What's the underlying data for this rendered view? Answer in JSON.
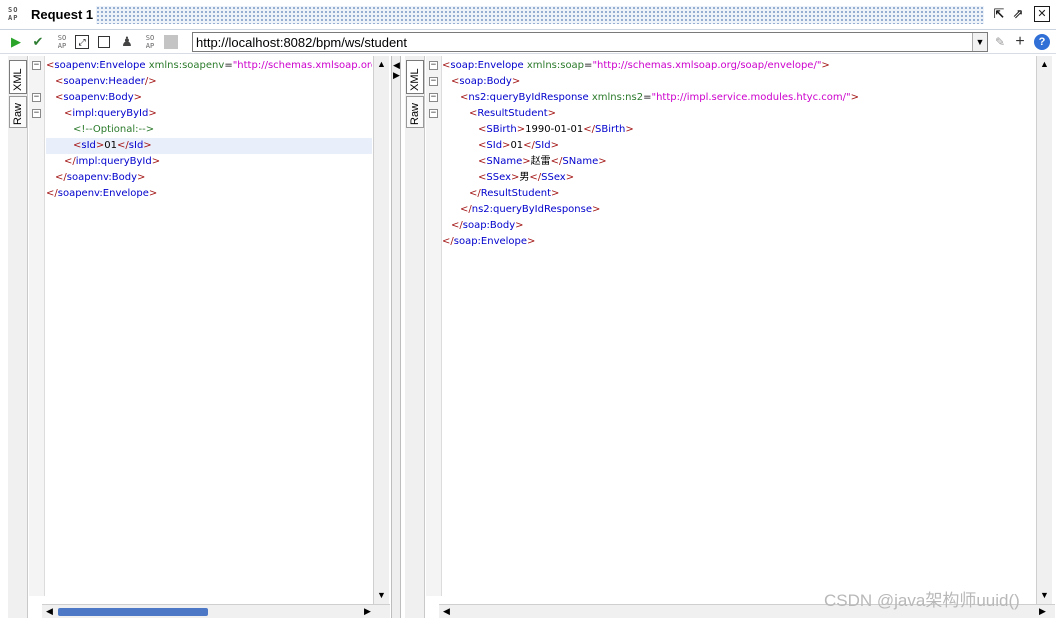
{
  "titlebar": {
    "logo": "SO\nAP",
    "title": "Request 1"
  },
  "toolbar": {
    "url": "http://localhost:8082/bpm/ws/student"
  },
  "request_panel": {
    "tabs": [
      "XML",
      "Raw"
    ],
    "lines": [
      {
        "fold": "−",
        "indent": 0,
        "parts": [
          [
            "t",
            "<"
          ],
          [
            "n",
            "soapenv:Envelope "
          ],
          [
            "a",
            "xmlns:soapenv"
          ],
          [
            "x",
            "="
          ],
          [
            "v",
            "\"http://schemas.xmlsoap.org/so"
          ]
        ]
      },
      {
        "fold": "",
        "indent": 1,
        "parts": [
          [
            "t",
            "<"
          ],
          [
            "n",
            "soapenv:Header"
          ],
          [
            "t",
            "/>"
          ]
        ]
      },
      {
        "fold": "−",
        "indent": 1,
        "parts": [
          [
            "t",
            "<"
          ],
          [
            "n",
            "soapenv:Body"
          ],
          [
            "t",
            ">"
          ]
        ]
      },
      {
        "fold": "−",
        "indent": 2,
        "parts": [
          [
            "t",
            "<"
          ],
          [
            "n",
            "impl:queryById"
          ],
          [
            "t",
            ">"
          ]
        ]
      },
      {
        "fold": "",
        "indent": 3,
        "parts": [
          [
            "c",
            "<!--Optional:-->"
          ]
        ]
      },
      {
        "fold": "",
        "indent": 3,
        "hl": true,
        "parts": [
          [
            "t",
            "<"
          ],
          [
            "n",
            "sId"
          ],
          [
            "t",
            ">"
          ],
          [
            "x",
            "01"
          ],
          [
            "t",
            "</"
          ],
          [
            "n",
            "sId"
          ],
          [
            "t",
            ">"
          ]
        ]
      },
      {
        "fold": "",
        "indent": 2,
        "parts": [
          [
            "t",
            "</"
          ],
          [
            "n",
            "impl:queryById"
          ],
          [
            "t",
            ">"
          ]
        ]
      },
      {
        "fold": "",
        "indent": 1,
        "parts": [
          [
            "t",
            "</"
          ],
          [
            "n",
            "soapenv:Body"
          ],
          [
            "t",
            ">"
          ]
        ]
      },
      {
        "fold": "",
        "indent": 0,
        "parts": [
          [
            "t",
            "</"
          ],
          [
            "n",
            "soapenv:Envelope"
          ],
          [
            "t",
            ">"
          ]
        ]
      }
    ]
  },
  "response_panel": {
    "tabs": [
      "XML",
      "Raw"
    ],
    "lines": [
      {
        "fold": "−",
        "indent": 0,
        "parts": [
          [
            "t",
            "<"
          ],
          [
            "n",
            "soap:Envelope "
          ],
          [
            "a",
            "xmlns:soap"
          ],
          [
            "x",
            "="
          ],
          [
            "v",
            "\"http://schemas.xmlsoap.org/soap/envelope/\""
          ],
          [
            "t",
            ">"
          ]
        ]
      },
      {
        "fold": "−",
        "indent": 1,
        "parts": [
          [
            "t",
            "<"
          ],
          [
            "n",
            "soap:Body"
          ],
          [
            "t",
            ">"
          ]
        ]
      },
      {
        "fold": "−",
        "indent": 2,
        "parts": [
          [
            "t",
            "<"
          ],
          [
            "n",
            "ns2:queryByIdResponse "
          ],
          [
            "a",
            "xmlns:ns2"
          ],
          [
            "x",
            "="
          ],
          [
            "v",
            "\"http://impl.service.modules.htyc.com/\""
          ],
          [
            "t",
            ">"
          ]
        ]
      },
      {
        "fold": "−",
        "indent": 3,
        "parts": [
          [
            "t",
            "<"
          ],
          [
            "n",
            "ResultStudent"
          ],
          [
            "t",
            ">"
          ]
        ]
      },
      {
        "fold": "",
        "indent": 4,
        "parts": [
          [
            "t",
            "<"
          ],
          [
            "n",
            "SBirth"
          ],
          [
            "t",
            ">"
          ],
          [
            "x",
            "1990-01-01"
          ],
          [
            "t",
            "</"
          ],
          [
            "n",
            "SBirth"
          ],
          [
            "t",
            ">"
          ]
        ]
      },
      {
        "fold": "",
        "indent": 4,
        "parts": [
          [
            "t",
            "<"
          ],
          [
            "n",
            "SId"
          ],
          [
            "t",
            ">"
          ],
          [
            "x",
            "01"
          ],
          [
            "t",
            "</"
          ],
          [
            "n",
            "SId"
          ],
          [
            "t",
            ">"
          ]
        ]
      },
      {
        "fold": "",
        "indent": 4,
        "parts": [
          [
            "t",
            "<"
          ],
          [
            "n",
            "SName"
          ],
          [
            "t",
            ">"
          ],
          [
            "x",
            "赵雷"
          ],
          [
            "t",
            "</"
          ],
          [
            "n",
            "SName"
          ],
          [
            "t",
            ">"
          ]
        ]
      },
      {
        "fold": "",
        "indent": 4,
        "parts": [
          [
            "t",
            "<"
          ],
          [
            "n",
            "SSex"
          ],
          [
            "t",
            ">"
          ],
          [
            "x",
            "男"
          ],
          [
            "t",
            "</"
          ],
          [
            "n",
            "SSex"
          ],
          [
            "t",
            ">"
          ]
        ]
      },
      {
        "fold": "",
        "indent": 3,
        "parts": [
          [
            "t",
            "</"
          ],
          [
            "n",
            "ResultStudent"
          ],
          [
            "t",
            ">"
          ]
        ]
      },
      {
        "fold": "",
        "indent": 2,
        "parts": [
          [
            "t",
            "</"
          ],
          [
            "n",
            "ns2:queryByIdResponse"
          ],
          [
            "t",
            ">"
          ]
        ]
      },
      {
        "fold": "",
        "indent": 1,
        "parts": [
          [
            "t",
            "</"
          ],
          [
            "n",
            "soap:Body"
          ],
          [
            "t",
            ">"
          ]
        ]
      },
      {
        "fold": "",
        "indent": 0,
        "parts": [
          [
            "t",
            "</"
          ],
          [
            "n",
            "soap:Envelope"
          ],
          [
            "t",
            ">"
          ]
        ]
      }
    ]
  },
  "watermark": "CSDN @java架构师uuid()",
  "colors": {
    "tag_bracket": "#a31515",
    "tag_name": "#0000cc",
    "attr_name": "#2b7a2b",
    "attr_value": "#cc00cc",
    "run_icon": "#2aa52a",
    "accent": "#4c78c6"
  },
  "icons": {
    "run": "play-icon",
    "validate": "validate-icon",
    "ws_addressing": "soap-small-icon",
    "cancel": "cancel-icon",
    "new_window": "new-window-icon",
    "user": "user-icon",
    "soap_small_2": "soap-small-icon",
    "grey_box": "grey-box-icon",
    "help": "help-icon"
  }
}
